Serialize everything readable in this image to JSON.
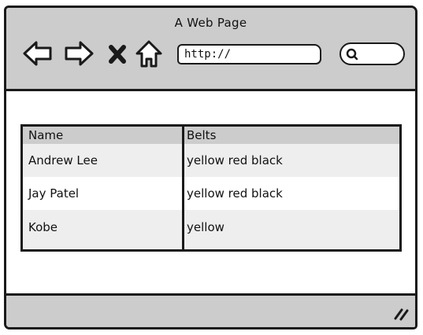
{
  "window": {
    "title": "A Web Page"
  },
  "toolbar": {
    "icons": [
      "back-arrow-icon",
      "forward-arrow-icon",
      "close-x-icon",
      "home-icon",
      "search-icon"
    ],
    "url": {
      "value": "http://"
    }
  },
  "table": {
    "columns": [
      "Name",
      "Belts"
    ],
    "rows": [
      [
        "Andrew Lee",
        "yellow red black"
      ],
      [
        "Jay Patel",
        "yellow red black"
      ],
      [
        "Kobe",
        "yellow"
      ]
    ]
  },
  "colors": {
    "chrome": "#cccccc",
    "header_row": "#cccccc",
    "alt_row": "#eeeeee",
    "stroke": "#1a1a1a"
  }
}
